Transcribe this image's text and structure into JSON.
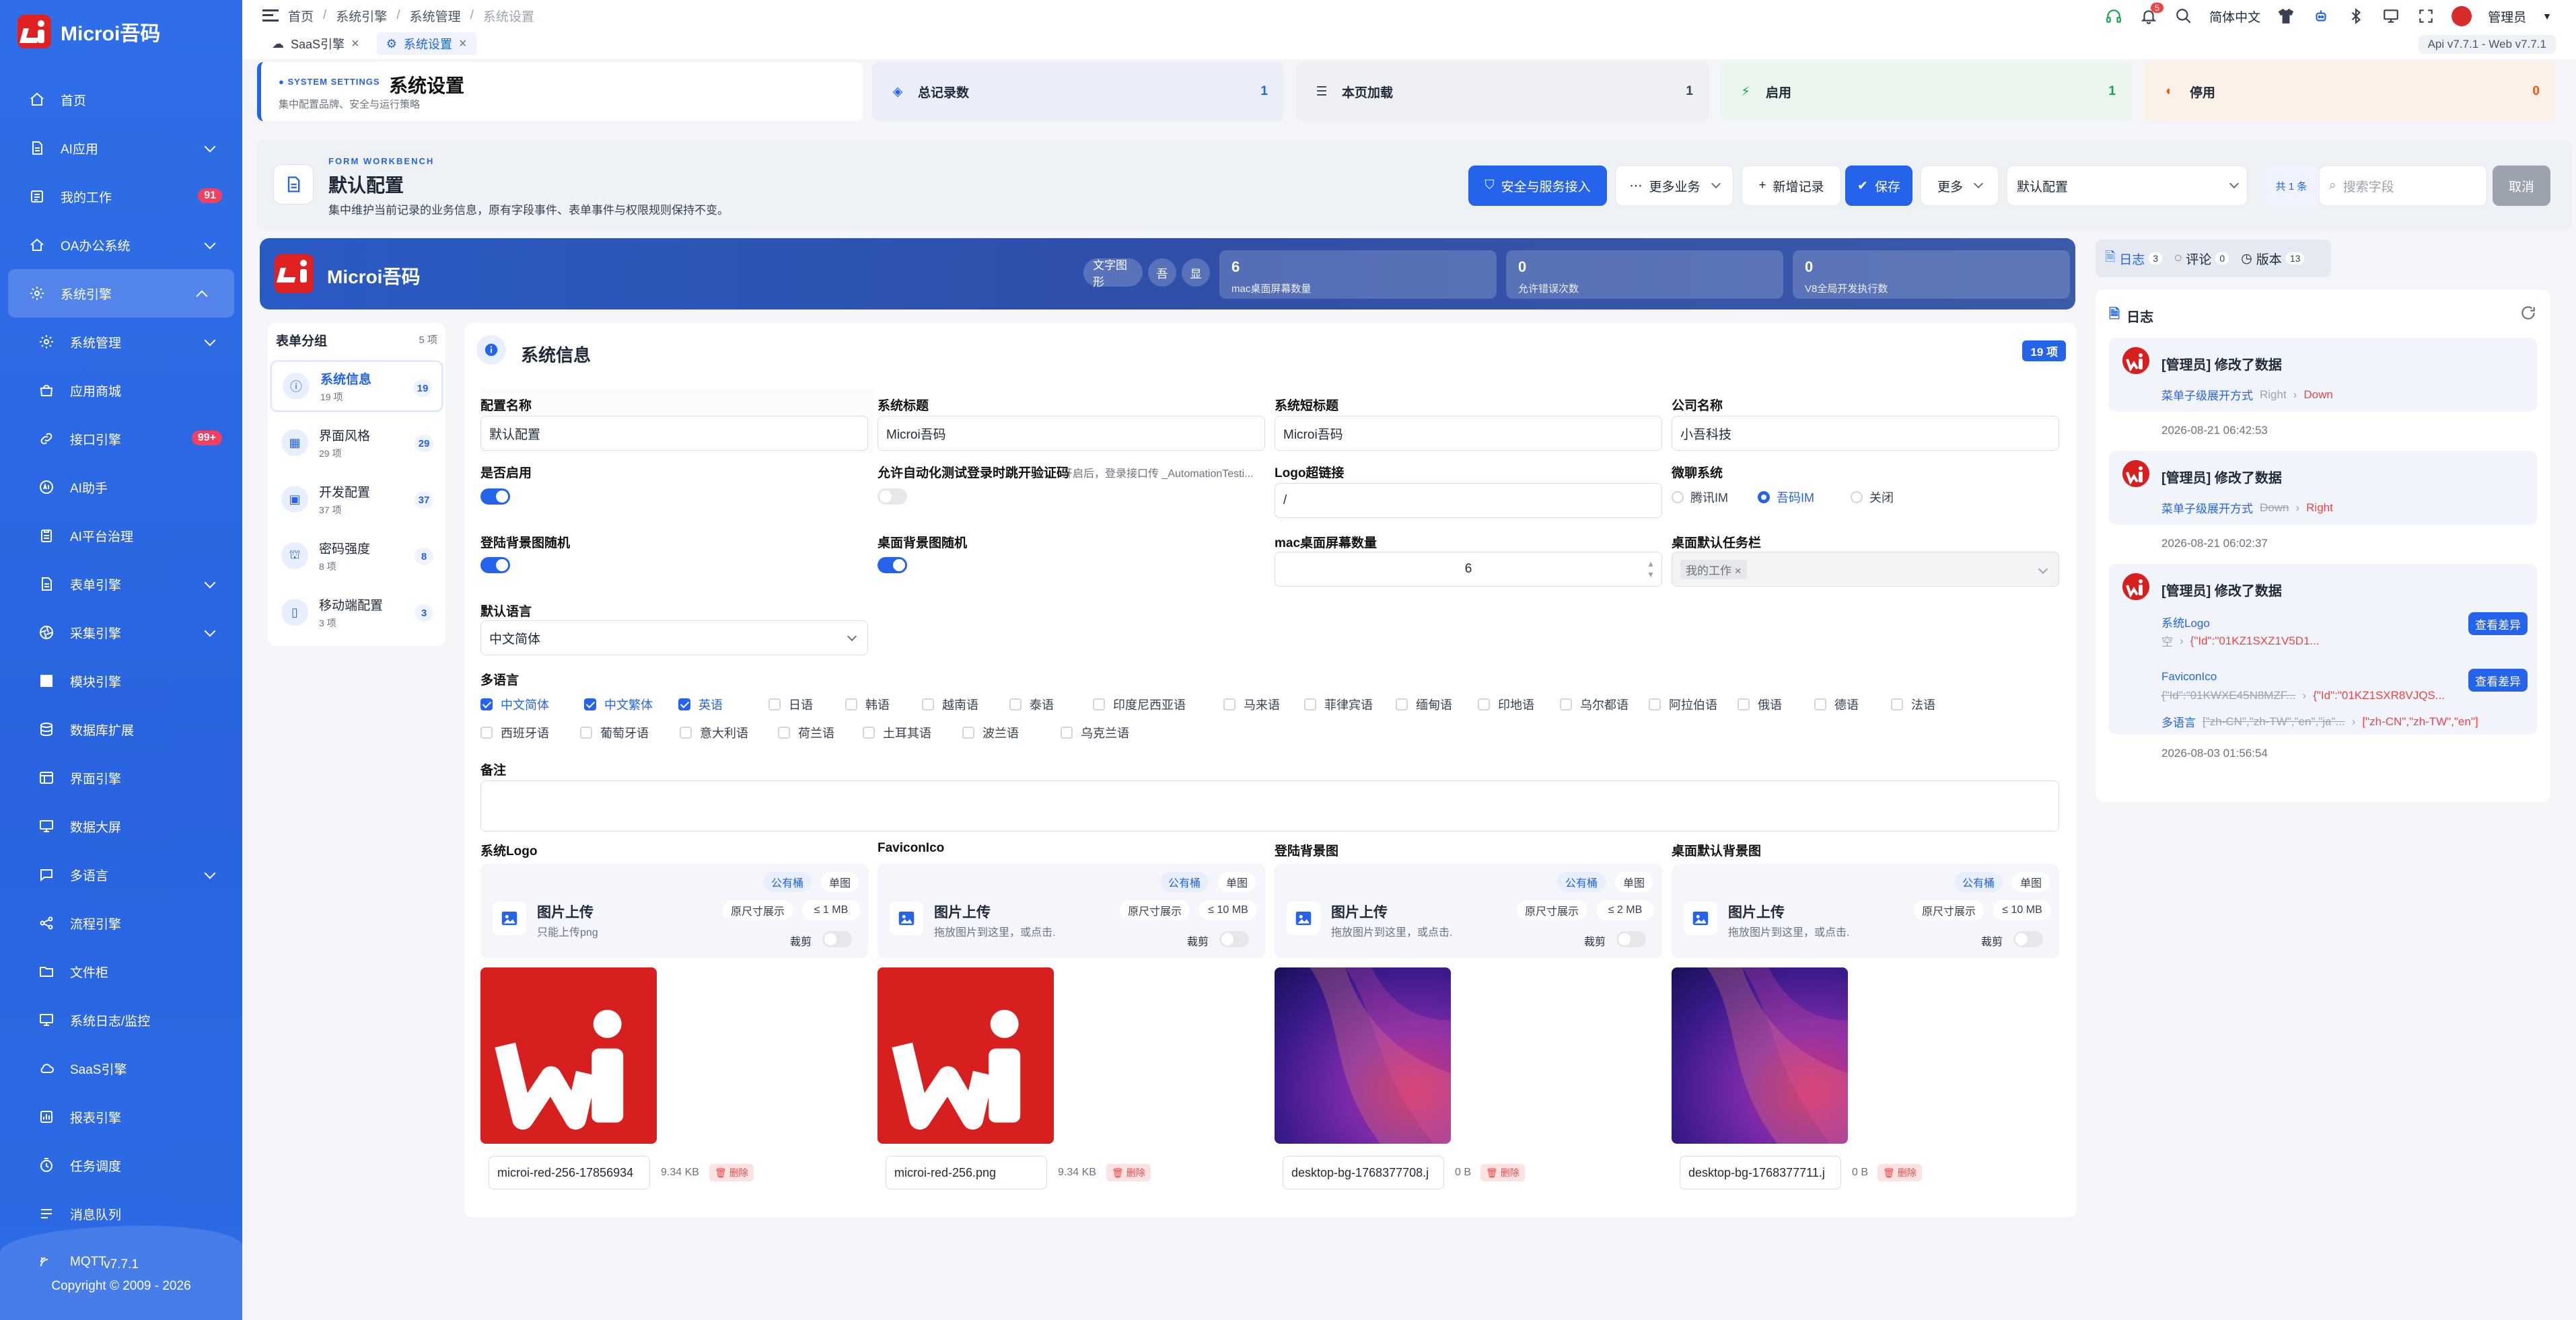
{
  "sidebar": {
    "brand": "Microi吾码",
    "items": [
      {
        "label": "首页",
        "icon": "home-icon"
      },
      {
        "label": "AI应用",
        "icon": "doc-icon",
        "chev": true
      },
      {
        "label": "我的工作",
        "icon": "work-icon",
        "badge": "91"
      },
      {
        "label": "OA办公系统",
        "icon": "oa-icon",
        "chev": true
      },
      {
        "label": "系统引擎",
        "icon": "gear-icon",
        "chev": true,
        "active": true
      },
      {
        "label": "系统管理",
        "icon": "gear-icon",
        "chev": true,
        "sub": true
      },
      {
        "label": "应用商城",
        "icon": "store-icon",
        "sub": true
      },
      {
        "label": "接口引擎",
        "icon": "link-icon",
        "badge": "99+",
        "sub": true
      },
      {
        "label": "AI助手",
        "icon": "ai-icon",
        "sub": true
      },
      {
        "label": "AI平台治理",
        "icon": "clipboard-icon",
        "sub": true
      },
      {
        "label": "表单引擎",
        "icon": "doc-icon",
        "chev": true,
        "sub": true
      },
      {
        "label": "采集引擎",
        "icon": "aperture-icon",
        "chev": true,
        "sub": true
      },
      {
        "label": "模块引擎",
        "icon": "grid-icon",
        "sub": true
      },
      {
        "label": "数据库扩展",
        "icon": "database-icon",
        "sub": true
      },
      {
        "label": "界面引擎",
        "icon": "layout-icon",
        "sub": true
      },
      {
        "label": "数据大屏",
        "icon": "monitor-icon",
        "sub": true
      },
      {
        "label": "多语言",
        "icon": "chat-icon",
        "chev": true,
        "sub": true
      },
      {
        "label": "流程引擎",
        "icon": "share-icon",
        "sub": true
      },
      {
        "label": "文件柜",
        "icon": "folder-icon",
        "sub": true
      },
      {
        "label": "系统日志/监控",
        "icon": "monitor-icon",
        "sub": true
      },
      {
        "label": "SaaS引擎",
        "icon": "cloud-icon",
        "sub": true
      },
      {
        "label": "报表引擎",
        "icon": "report-icon",
        "sub": true
      },
      {
        "label": "任务调度",
        "icon": "timer-icon",
        "sub": true
      },
      {
        "label": "消息队列",
        "icon": "queue-icon",
        "sub": true
      },
      {
        "label": "MQTT",
        "icon": "mqtt-icon",
        "sub": true
      }
    ],
    "version": "v7.7.1",
    "copyright": "Copyright © 2009 - 2026"
  },
  "topbar": {
    "breadcrumbs": [
      "首页",
      "系统引擎",
      "系统管理",
      "系统设置"
    ],
    "tabs": [
      {
        "label": "SaaS引擎",
        "active": false
      },
      {
        "label": "系统设置",
        "active": true
      }
    ],
    "language": "简体中文",
    "notif_count": "5",
    "user": "管理员",
    "api_version": "Api v7.7.1 - Web v7.7.1"
  },
  "header": {
    "tag": "SYSTEM SETTINGS",
    "title": "系统设置",
    "subtitle": "集中配置品牌、安全与运行策略"
  },
  "stats": [
    {
      "label": "总记录数",
      "value": "1",
      "bg": "#e9eef9",
      "color": "#2563eb"
    },
    {
      "label": "本页加载",
      "value": "1",
      "bg": "#eef0f4",
      "color": "#374151"
    },
    {
      "label": "启用",
      "value": "1",
      "bg": "#eaf6ee",
      "color": "#16a34a"
    },
    {
      "label": "停用",
      "value": "0",
      "bg": "#fbf1e6",
      "color": "#ea580c"
    }
  ],
  "workbench": {
    "tag": "FORM WORKBENCH",
    "title": "默认配置",
    "subtitle": "集中维护当前记录的业务信息，原有字段事件、表单事件与权限规则保持不变。",
    "btn_security": "安全与服务接入",
    "btn_more_biz": "更多业务",
    "btn_add": "新增记录",
    "btn_save": "保存",
    "btn_more": "更多",
    "select_value": "默认配置",
    "count_chip": "共 1 条",
    "search_placeholder": "搜索字段",
    "btn_cancel": "取消"
  },
  "banner": {
    "title": "Microi吾码",
    "chips": [
      "文字图形",
      "吾",
      "显"
    ],
    "stats": [
      {
        "num": "6",
        "label": "mac桌面屏幕数量"
      },
      {
        "num": "0",
        "label": "允许错误次数"
      },
      {
        "num": "0",
        "label": "V8全局开发执行数"
      }
    ]
  },
  "groups": {
    "title": "表单分组",
    "count": "5 项",
    "items": [
      {
        "name": "系统信息",
        "sub": "19 项",
        "count": "19",
        "active": true
      },
      {
        "name": "界面风格",
        "sub": "29 项",
        "count": "29"
      },
      {
        "name": "开发配置",
        "sub": "37 项",
        "count": "37"
      },
      {
        "name": "密码强度",
        "sub": "8 项",
        "count": "8"
      },
      {
        "name": "移动端配置",
        "sub": "3 项",
        "count": "3"
      }
    ]
  },
  "form": {
    "title": "系统信息",
    "count": "19 项",
    "config_name_label": "配置名称",
    "config_name": "默认配置",
    "sys_title_label": "系统标题",
    "sys_title": "Microi吾码",
    "sys_short_label": "系统短标题",
    "sys_short": "Microi吾码",
    "company_label": "公司名称",
    "company": "小吾科技",
    "enabled_label": "是否启用",
    "autotest_label": "允许自动化测试登录时跳开验证码",
    "autotest_hint": "开启后，登录接口传 _AutomationTesti...",
    "logo_link_label": "Logo超链接",
    "logo_link": "/",
    "im_label": "微聊系统",
    "im_options": [
      "腾讯IM",
      "吾码IM",
      "关闭"
    ],
    "login_bg_label": "登陆背景图随机",
    "desk_bg_label": "桌面背景图随机",
    "mac_screens_label": "mac桌面屏幕数量",
    "mac_screens": "6",
    "taskbar_label": "桌面默认任务栏",
    "taskbar_tag": "我的工作",
    "lang_label": "默认语言",
    "lang_value": "中文简体",
    "multi_lang_label": "多语言",
    "languages": [
      {
        "name": "中文简体",
        "on": true
      },
      {
        "name": "中文繁体",
        "on": true
      },
      {
        "name": "英语",
        "on": true
      },
      {
        "name": "日语"
      },
      {
        "name": "韩语"
      },
      {
        "name": "越南语"
      },
      {
        "name": "泰语"
      },
      {
        "name": "印度尼西亚语"
      },
      {
        "name": "马来语"
      },
      {
        "name": "菲律宾语"
      },
      {
        "name": "缅甸语"
      },
      {
        "name": "印地语"
      },
      {
        "name": "乌尔都语"
      },
      {
        "name": "阿拉伯语"
      },
      {
        "name": "俄语"
      },
      {
        "name": "德语"
      },
      {
        "name": "法语"
      },
      {
        "name": "西班牙语"
      },
      {
        "name": "葡萄牙语"
      },
      {
        "name": "意大利语"
      },
      {
        "name": "荷兰语"
      },
      {
        "name": "土耳其语"
      },
      {
        "name": "波兰语"
      },
      {
        "name": "乌克兰语"
      }
    ],
    "remark_label": "备注",
    "uploads": [
      {
        "label": "系统Logo",
        "hint": "只能上传png",
        "size_limit": "≤ 1 MB",
        "file": "microi-red-256-17856934",
        "fsize": "9.34 KB",
        "kind": "logo"
      },
      {
        "label": "FaviconIco",
        "hint": "拖放图片到这里，或点击...",
        "size_limit": "≤ 10 MB",
        "file": "microi-red-256.png",
        "fsize": "9.34 KB",
        "kind": "logo"
      },
      {
        "label": "登陆背景图",
        "hint": "拖放图片到这里，或点击...",
        "size_limit": "≤ 2 MB",
        "file": "desktop-bg-1768377708.j",
        "fsize": "0 B",
        "kind": "bg"
      },
      {
        "label": "桌面默认背景图",
        "hint": "拖放图片到这里，或点击...",
        "size_limit": "≤ 10 MB",
        "file": "desktop-bg-1768377711.j",
        "fsize": "0 B",
        "kind": "bg"
      }
    ],
    "upload_title": "图片上传",
    "pill_public": "公有桶",
    "pill_single": "单图",
    "pill_orig": "原尺寸展示",
    "crop_label": "裁剪",
    "delete_label": "删除"
  },
  "log": {
    "tabs": [
      {
        "label": "日志",
        "count": "3",
        "on": true
      },
      {
        "label": "评论",
        "count": "0"
      },
      {
        "label": "版本",
        "count": "13"
      }
    ],
    "title": "日志",
    "entries": [
      {
        "who": "[管理员] 修改了数据",
        "time": "2026-08-21 06:42:53",
        "rows": [
          {
            "k": "菜单子级展开方式",
            "o": "Right",
            "n": "Down"
          }
        ]
      },
      {
        "who": "[管理员] 修改了数据",
        "time": "2026-08-21 06:02:37",
        "rows": [
          {
            "k": "菜单子级展开方式",
            "o": "Down",
            "n": "Right",
            "strike": true
          }
        ]
      },
      {
        "who": "[管理员] 修改了数据",
        "time": "2026-08-03 01:56:54",
        "rows": [
          {
            "k": "系统Logo",
            "o": "空",
            "n": "{\"Id\":\"01KZ1SXZ1V5D1...",
            "diff": true
          },
          {
            "k": "FaviconIco",
            "o": "{\"Id\":\"01KWXE45N8MZF...",
            "n": "{\"Id\":\"01KZ1SXR8VJQS...",
            "diff": true,
            "strike": true
          },
          {
            "k": "多语言",
            "o": "[\"zh-CN\",\"zh-TW\",\"en\",\"ja\"...",
            "n": "[\"zh-CN\",\"zh-TW\",\"en\"]",
            "strike": true
          }
        ]
      }
    ],
    "diff_label": "查看差异"
  }
}
